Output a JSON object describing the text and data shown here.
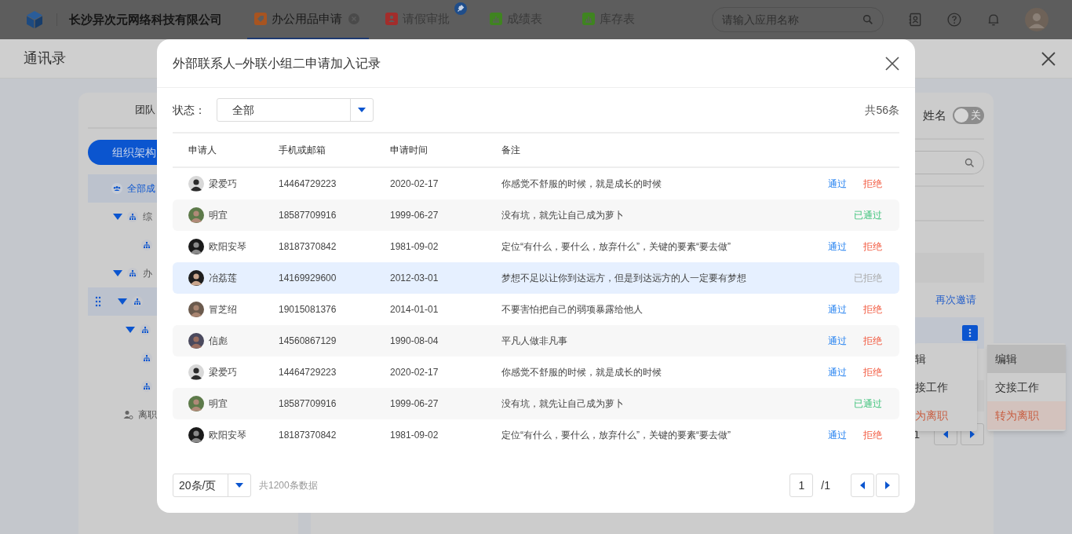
{
  "top_bar": {
    "company": "长沙异次元网络科技有限公司",
    "tabs": [
      {
        "label": "办公用品申请",
        "kind": "tag",
        "selected": true,
        "closable": true,
        "pinned": false
      },
      {
        "label": "请假审批",
        "kind": "person",
        "selected": false,
        "closable": false,
        "pinned": true
      },
      {
        "label": "成绩表",
        "kind": "chart",
        "selected": false,
        "closable": false,
        "pinned": false
      },
      {
        "label": "库存表",
        "kind": "chart",
        "selected": false,
        "closable": false,
        "pinned": false
      }
    ],
    "search": {
      "placeholder": "请输入应用名称"
    }
  },
  "drawer": {
    "title": "通讯录",
    "left_panel": {
      "tab": "团队",
      "button": "组织架构",
      "tree": [
        {
          "label": "全部成",
          "kind": "group",
          "selected": true
        },
        {
          "label": "综",
          "kind": "org",
          "expanded": true,
          "selected": false,
          "children": [
            {
              "kind": "org",
              "selected": false
            }
          ]
        },
        {
          "label": "办",
          "kind": "org",
          "expanded": true,
          "selected": false,
          "children": [
            {
              "kind": "org",
              "expanded": true,
              "selected": true,
              "draggable": true,
              "children": [
                {
                  "kind": "org",
                  "expanded": true,
                  "selected": false,
                  "children": [
                    {
                      "kind": "org",
                      "selected": false
                    },
                    {
                      "kind": "org",
                      "selected": false
                    }
                  ]
                }
              ]
            }
          ]
        },
        {
          "label": "离职",
          "kind": "person",
          "selected": false
        }
      ]
    },
    "right_panel": {
      "name_label": "姓名",
      "name_toggle": {
        "on": false,
        "label": "关"
      },
      "link": "再次邀请",
      "menus": [
        {
          "items": [
            {
              "label": "辑",
              "kind": "normal",
              "selected": false
            },
            {
              "label": "接工作",
              "kind": "normal",
              "selected": false
            },
            {
              "label": "为离职",
              "kind": "danger",
              "selected": false
            }
          ]
        },
        {
          "items": [
            {
              "label": "编辑",
              "kind": "normal",
              "selected": true
            },
            {
              "label": "交接工作",
              "kind": "normal",
              "selected": false
            },
            {
              "label": "转为离职",
              "kind": "danger",
              "selected": true
            }
          ]
        }
      ],
      "page": "1"
    }
  },
  "modal": {
    "title": "外部联系人–外联小组二申请加入记录",
    "filter": {
      "label": "状态：",
      "value": "全部"
    },
    "total": "共56条",
    "columns": [
      "申请人",
      "手机或邮箱",
      "申请时间",
      "备注"
    ],
    "rows": [
      {
        "name": "梁爱巧",
        "contact": "14464729223",
        "date": "2020-02-17",
        "note": "你感觉不舒服的时候，就是成长的时候",
        "kind": "pending",
        "approve": "通过",
        "reject": "拒绝",
        "selected": false
      },
      {
        "name": "明宜",
        "contact": "18587709916",
        "date": "1999-06-27",
        "note": "没有坑，就先让自己成为萝卜",
        "kind": "approved",
        "status_text": "已通过",
        "selected": false
      },
      {
        "name": "欧阳安琴",
        "contact": "18187370842",
        "date": "1981-09-02",
        "note": "定位“有什么，要什么，放弃什么”，关键的要素“要去做”",
        "kind": "pending",
        "approve": "通过",
        "reject": "拒绝",
        "selected": false
      },
      {
        "name": "冶荔莲",
        "contact": "14169929600",
        "date": "2012-03-01",
        "note": "梦想不足以让你到达远方，但是到达远方的人一定要有梦想",
        "kind": "rejected",
        "status_text": "已拒绝",
        "selected": true
      },
      {
        "name": "冒芝绍",
        "contact": "19015081376",
        "date": "2014-01-01",
        "note": "不要害怕把自己的弱项暴露给他人",
        "kind": "pending",
        "approve": "通过",
        "reject": "拒绝",
        "selected": false
      },
      {
        "name": "信彪",
        "contact": "14560867129",
        "date": "1990-08-04",
        "note": "平凡人做非凡事",
        "kind": "pending",
        "approve": "通过",
        "reject": "拒绝",
        "selected": false
      },
      {
        "name": "梁爱巧",
        "contact": "14464729223",
        "date": "2020-02-17",
        "note": "你感觉不舒服的时候，就是成长的时候",
        "kind": "pending",
        "approve": "通过",
        "reject": "拒绝",
        "selected": false
      },
      {
        "name": "明宜",
        "contact": "18587709916",
        "date": "1999-06-27",
        "note": "没有坑，就先让自己成为萝卜",
        "kind": "approved",
        "status_text": "已通过",
        "selected": false
      },
      {
        "name": "欧阳安琴",
        "contact": "18187370842",
        "date": "1981-09-02",
        "note": "定位“有什么，要什么，放弃什么”，关键的要素“要去做”",
        "kind": "pending",
        "approve": "通过",
        "reject": "拒绝",
        "selected": false
      }
    ],
    "page_size": "20条/页",
    "total_records": "共1200条数据",
    "page": "1",
    "page_count": "/1"
  }
}
